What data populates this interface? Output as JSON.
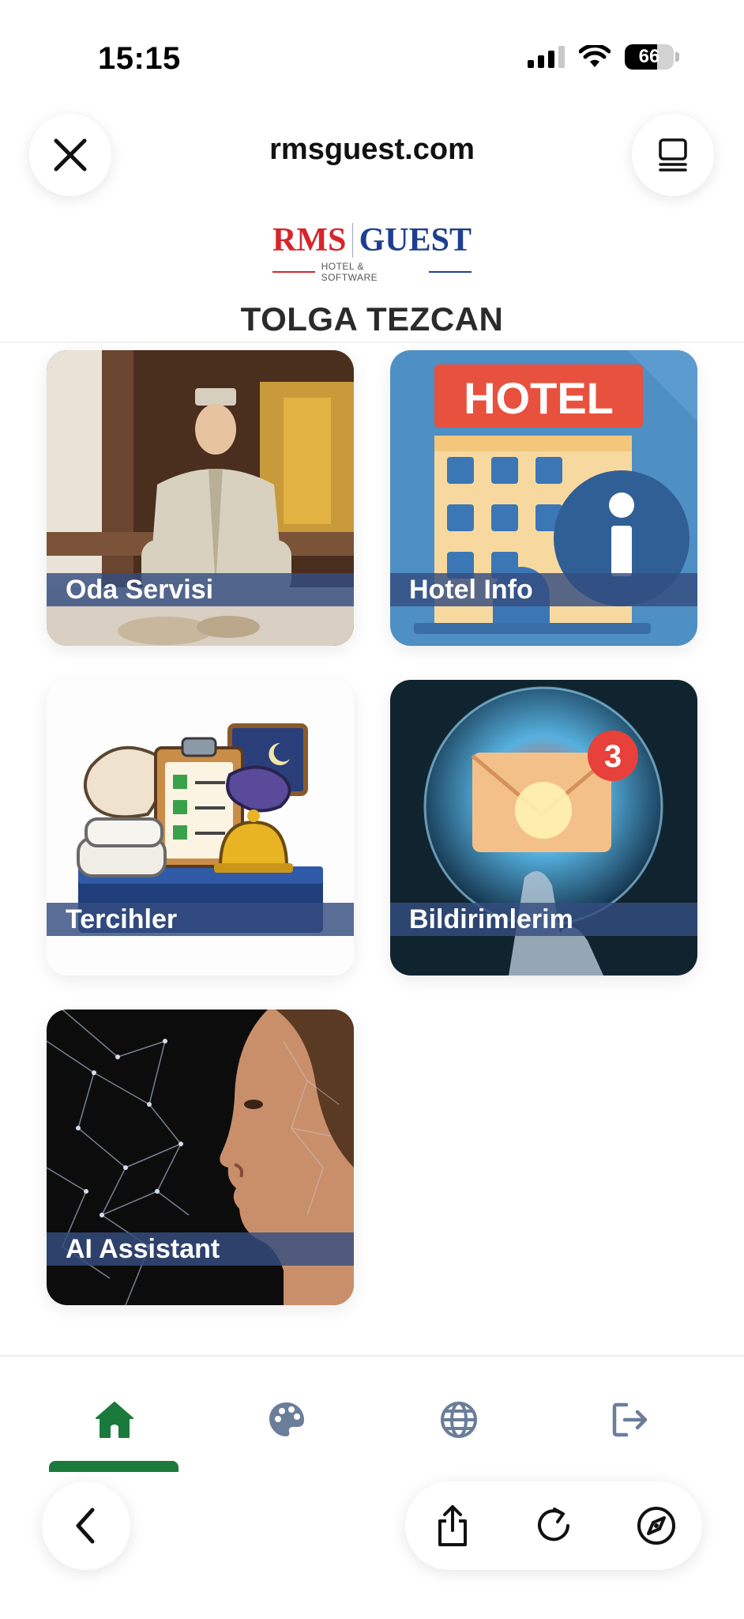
{
  "status_bar": {
    "time": "15:15",
    "battery": "66",
    "battery_level": 0.66,
    "icons": [
      "signal-icon",
      "wifi-icon",
      "battery-icon"
    ]
  },
  "browser": {
    "url": "rmsguest.com",
    "close_icon": "close-icon",
    "tabs_icon": "tabs-icon"
  },
  "brand": {
    "logo_left": "RMS",
    "logo_right": "GUEST",
    "logo_sub": "HOTEL & SOFTWARE",
    "colors": {
      "red": "#d6262b",
      "blue": "#1e3f8f"
    }
  },
  "guest": {
    "name": "TOLGA TEZCAN"
  },
  "tiles": [
    {
      "label": "Oda Servisi",
      "image": "room-service-photo"
    },
    {
      "label": "Hotel Info",
      "image": "hotel-info-illustration",
      "sign": "HOTEL"
    },
    {
      "label": "Tercihler",
      "image": "preferences-illustration"
    },
    {
      "label": "Bildirimlerim",
      "image": "notifications-illustration",
      "badge": "3"
    },
    {
      "label": "AI Assistant",
      "image": "ai-faces-illustration"
    }
  ],
  "bottom_nav": {
    "items": [
      {
        "icon": "home-icon",
        "active": true,
        "color": "#1a7a3c"
      },
      {
        "icon": "palette-icon",
        "active": false,
        "color": "#6b7d99"
      },
      {
        "icon": "globe-icon",
        "active": false,
        "color": "#6b7d99"
      },
      {
        "icon": "logout-icon",
        "active": false,
        "color": "#6b7d99"
      }
    ]
  },
  "safari_bar": {
    "icons": [
      "back-icon",
      "share-icon",
      "reload-icon",
      "compass-icon"
    ]
  }
}
